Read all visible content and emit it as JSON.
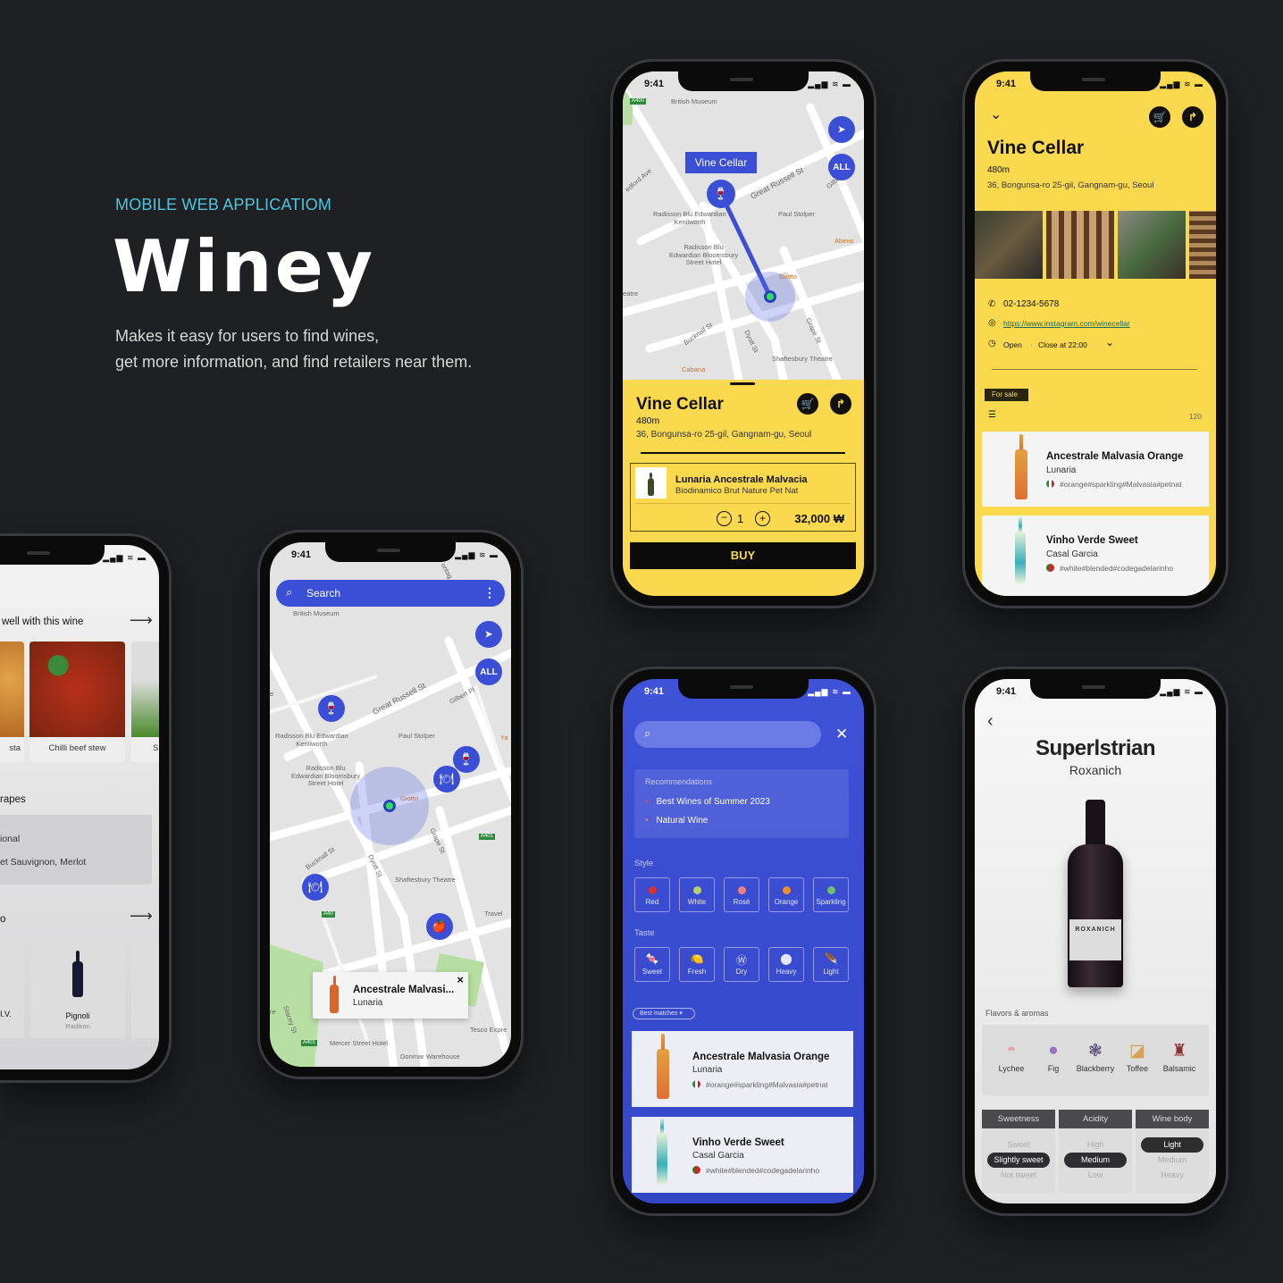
{
  "hero": {
    "label": "MOBILE WEB APPLICATIOM",
    "title": "Winey",
    "desc_line1": "Makes it easy for users to find wines,",
    "desc_line2": "get more information, and find retailers near them."
  },
  "status": {
    "time": "9:41",
    "icons": "▂▄▆ ≋ ▬"
  },
  "pairing_screen": {
    "pair_title": "well with this wine",
    "arrow": "⟶",
    "foods": [
      "sta",
      "Chilli beef stew",
      "S"
    ],
    "grapes_title": "rapes",
    "grapes_row1": "ional",
    "grapes_row2": "et Sauvignon, Merlot",
    "similar_title": "o",
    "wines": [
      {
        "name": "I.V."
      },
      {
        "name": "Pignoli",
        "producer": "Radikon"
      }
    ]
  },
  "map_screen": {
    "search_placeholder": "Search",
    "menu_icon": "⋮",
    "all_label": "ALL",
    "map_labels": [
      "British Museum",
      "Great Russell St",
      "Gilbert Pl",
      "Radisson Blu Edwardian\nKenilworth",
      "Paul Stolper",
      "Radisson Blu\nEdwardian Bloomsbury\nStreet Hotel",
      "Giotto",
      "Bucknall St",
      "Dyott St",
      "Grape St",
      "Shaftesbury Theatre",
      "A401",
      "A40",
      "Travel",
      "Stacey St",
      "Mercer Street Hotel",
      "Donmar Warehouse",
      "Tesco Expre",
      "A401",
      "Ya",
      "ontag",
      "re",
      "e"
    ],
    "popup": {
      "name": "Ancestrale Malvasi...",
      "producer": "Lunaria",
      "close": "×"
    }
  },
  "store_map_screen": {
    "map_labels": [
      "A400",
      "British Museum",
      "edford Ave",
      "Great Russell St",
      "Gilbert Pl",
      "Radisson Blu Edwardian\nKenilworth",
      "Paul Stolper",
      "Abeno",
      "Radisson Blu\nEdwardian Bloomsbury\nStreet Hotel",
      "Giotto",
      "eatre",
      "Bucknall St",
      "Dyott St",
      "Grape St",
      "Shaftesbury Theatre",
      "Cabana"
    ],
    "tag": "Vine Cellar",
    "all_label": "ALL",
    "store": {
      "name": "Vine Cellar",
      "distance": "480m",
      "address": "36, Bongunsa-ro 25-gil, Gangnam-gu, Seoul"
    },
    "product": {
      "name": "Lunaria Ancestrale Malvacia",
      "subtitle": "Biodinamico Brut Nature Pet Nat",
      "qty": "1",
      "price": "32,000 ₩",
      "minus": "−",
      "plus": "+"
    },
    "buy_label": "BUY"
  },
  "store_detail_screen": {
    "store": {
      "name": "Vine Cellar",
      "distance": "480m",
      "address": "36, Bongunsa-ro 25-gil, Gangnam-gu, Seoul"
    },
    "phone": "02-1234-5678",
    "instagram": "https://www.instagram.com/winecellar",
    "open": "Open",
    "sep": "·",
    "close_time": "Close at 22:00",
    "for_sale": "For sale",
    "count": "120",
    "wines": [
      {
        "name": "Ancestrale Malvasia Orange",
        "producer": "Lunaria",
        "tags": "#orange#sparkling#Malvasia#petnat",
        "flag": "italy"
      },
      {
        "name": "Vinho Verde Sweet",
        "producer": "Casal Garcia",
        "tags": "#white#blended#codegadelarinho",
        "flag": "portugal"
      }
    ]
  },
  "search_screen": {
    "recommendations_title": "Recommendations",
    "recommendations": [
      "Best Wines of Summer 2023",
      "Natural Wine"
    ],
    "style_title": "Style",
    "styles": [
      {
        "label": "Red",
        "color": "#e0302f"
      },
      {
        "label": "White",
        "color": "#b6cf6a"
      },
      {
        "label": "Rosé",
        "color": "#ef8080"
      },
      {
        "label": "Orange",
        "color": "#f0902a"
      },
      {
        "label": "Sparkling",
        "color": "#6fc06a"
      }
    ],
    "taste_title": "Taste",
    "tastes": [
      {
        "label": "Sweet",
        "icon": "candy-icon",
        "glyph": "🍬"
      },
      {
        "label": "Fresh",
        "icon": "lemon-icon",
        "glyph": "🍋"
      },
      {
        "label": "Dry",
        "icon": "dry-icon",
        "glyph": "Ⓦ"
      },
      {
        "label": "Heavy",
        "icon": "weight-icon",
        "glyph": "⬤"
      },
      {
        "label": "Light",
        "icon": "feather-icon",
        "glyph": "🪶"
      }
    ],
    "sort": "Best matches",
    "wines": [
      {
        "name": "Ancestrale Malvasia Orange",
        "producer": "Lunaria",
        "tags": "#orange#sparkling#Malvasia#petnat",
        "flag": "italy"
      },
      {
        "name": "Vinho Verde Sweet",
        "producer": "Casal Garcia",
        "tags": "#white#blended#codegadelarinho",
        "flag": "portugal"
      }
    ]
  },
  "wine_detail_screen": {
    "name": "Superlstrian",
    "producer": "Roxanich",
    "label_text": "ROXANICH",
    "flavors_title": "Flavors & aromas",
    "flavors": [
      {
        "label": "Lychee",
        "icon": "lychee-icon"
      },
      {
        "label": "Fig",
        "icon": "fig-icon"
      },
      {
        "label": "Blackberry",
        "icon": "blackberry-icon"
      },
      {
        "label": "Toffee",
        "icon": "toffee-icon"
      },
      {
        "label": "Balsamic",
        "icon": "balsamic-icon"
      }
    ],
    "scales": [
      {
        "title": "Sweetness",
        "options": [
          "Sweet",
          "Slightly sweet",
          "Not sweet"
        ],
        "selected": "Slightly sweet"
      },
      {
        "title": "Acidity",
        "options": [
          "High",
          "Medium",
          "Low"
        ],
        "selected": "Medium"
      },
      {
        "title": "Wine body",
        "options": [
          "Light",
          "Medium",
          "Heavy"
        ],
        "selected": "Light"
      }
    ]
  },
  "colors": {
    "background": "#1f2023",
    "accent_blue": "#3b4fd6",
    "yellow": "#fbd94f",
    "hero_label": "#4cc6dc"
  }
}
